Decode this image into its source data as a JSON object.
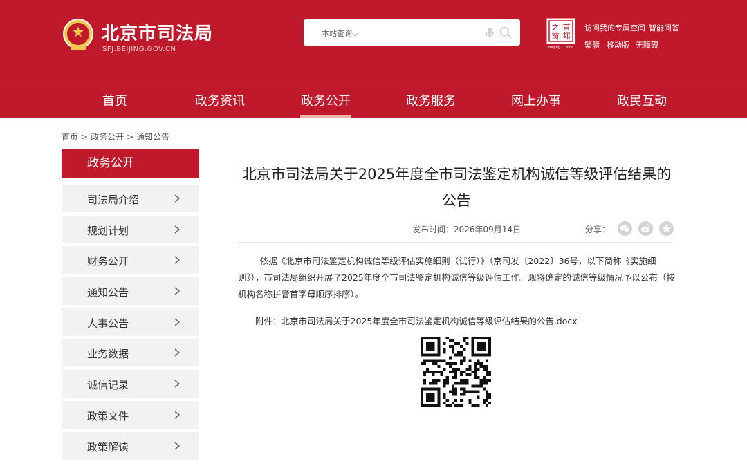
{
  "header": {
    "site_title": "北京市司法局",
    "site_domain": "SFJ.BEIJING.GOV.CN",
    "search": {
      "scope_label": "本站查询",
      "scope_arrow": "⌵"
    },
    "top_links": [
      "访问我的专属空间",
      "智能问答",
      "繁體",
      "移动版",
      "无障碍"
    ],
    "capital_logo_text": [
      "首",
      "都",
      "之",
      "窗",
      "Beijing · China"
    ],
    "accent_color": "#c0192b"
  },
  "nav": {
    "items": [
      "首页",
      "政务资讯",
      "政务公开",
      "政务服务",
      "网上办事",
      "政民互动"
    ],
    "active": "政务公开"
  },
  "breadcrumb": {
    "items": [
      "首页",
      "政务公开",
      "通知公告"
    ],
    "separator": ">"
  },
  "sidebar": {
    "title": "政务公开",
    "items": [
      "司法局介绍",
      "规划计划",
      "财务公开",
      "通知公告",
      "人事公告",
      "业务数据",
      "诚信记录",
      "政策文件",
      "政策解读"
    ]
  },
  "article": {
    "title_lines": [
      "北京市司法局关于2025年度全市司法鉴定机构诚信等级评估结果的",
      "公告"
    ],
    "published": "发布时间：2026年09月14日",
    "share_label": "分享：",
    "share_icons": [
      "wechat-icon",
      "weibo-icon",
      "star-icon"
    ],
    "body_lines": [
      "        依据《北京市司法鉴定机构诚信等级评估实施细则（试行）》（京司发〔2022〕36号，以下简称《实施细",
      "则》），市司法局组织开展了2025年度全市司法鉴定机构诚信等级评估工作。现将确定的诚信等级情况予以公布（按",
      "机构名称拼音首字母顺序排序）。"
    ],
    "attachment": "附件：北京市司法局关于2025年度全市司法鉴定机构诚信等级评估结果的公告.docx"
  }
}
